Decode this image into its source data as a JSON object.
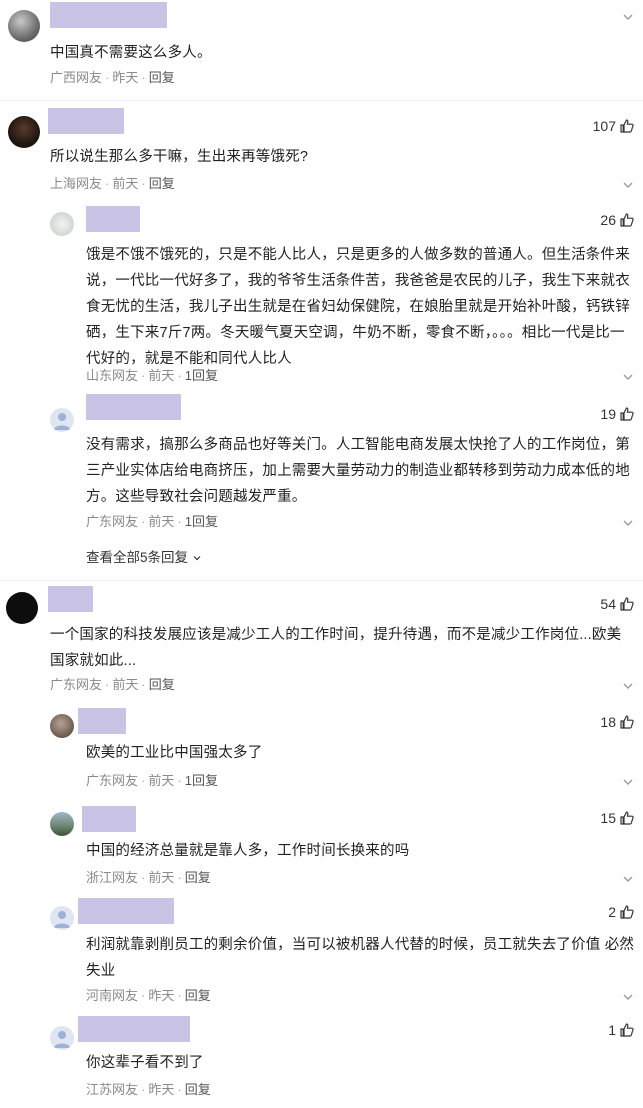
{
  "thread": {
    "c1": {
      "body": "中国真不需要这么多人。",
      "region": "广西网友",
      "time": "昨天",
      "reply": "回复",
      "likes": ""
    },
    "c2": {
      "body": "所以说生那么多干嘛，生出来再等饿死?",
      "region": "上海网友",
      "time": "前天",
      "reply": "回复",
      "likes": "107",
      "replies": [
        {
          "body": "饿是不饿不饿死的，只是不能人比人，只是更多的人做多数的普通人。但生活条件来说，一代比一代好多了，我的爷爷生活条件苦，我爸爸是农民的儿子，我生下来就衣食无忧的生活，我儿子出生就是在省妇幼保健院，在娘胎里就是开始补叶酸，钙铁锌硒，生下来7斤7两。冬天暖气夏天空调，牛奶不断，零食不断，。。。相比一代是比一代好的，就是不能和同代人比人",
          "region": "山东网友",
          "time": "前天",
          "reply": "1回复",
          "likes": "26"
        },
        {
          "body": "没有需求，搞那么多商品也好等关门。人工智能电商发展太快抢了人的工作岗位，第三产业实体店给电商挤压，加上需要大量劳动力的制造业都转移到劳动力成本低的地方。这些导致社会问题越发严重。",
          "region": "广东网友",
          "time": "前天",
          "reply": "1回复",
          "likes": "19"
        }
      ],
      "view_all": "查看全部5条回复"
    },
    "c3": {
      "body": "一个国家的科技发展应该是减少工人的工作时间，提升待遇，而不是减少工作岗位...欧美国家就如此...",
      "region": "广东网友",
      "time": "前天",
      "reply": "回复",
      "likes": "54",
      "replies": [
        {
          "body": "欧美的工业比中国强太多了",
          "region": "广东网友",
          "time": "前天",
          "reply": "1回复",
          "likes": "18"
        },
        {
          "body": "中国的经济总量就是靠人多，工作时间长换来的吗",
          "region": "浙江网友",
          "time": "前天",
          "reply": "回复",
          "likes": "15"
        },
        {
          "body": "利润就靠剥削员工的剩余价值，当可以被机器人代替的时候，员工就失去了价值 必然失业",
          "region": "河南网友",
          "time": "昨天",
          "reply": "回复",
          "likes": "2"
        },
        {
          "body": "你这辈子看不到了",
          "region": "江苏网友",
          "time": "昨天",
          "reply": "回复",
          "likes": "1"
        }
      ]
    }
  },
  "icons": {
    "like": "thumbs-up-icon",
    "more": "chevron-down-icon",
    "expand": "chevron-down-icon"
  },
  "colors": {
    "name_placeholder": "#c9c3e6",
    "meta": "#8a8a8a"
  }
}
